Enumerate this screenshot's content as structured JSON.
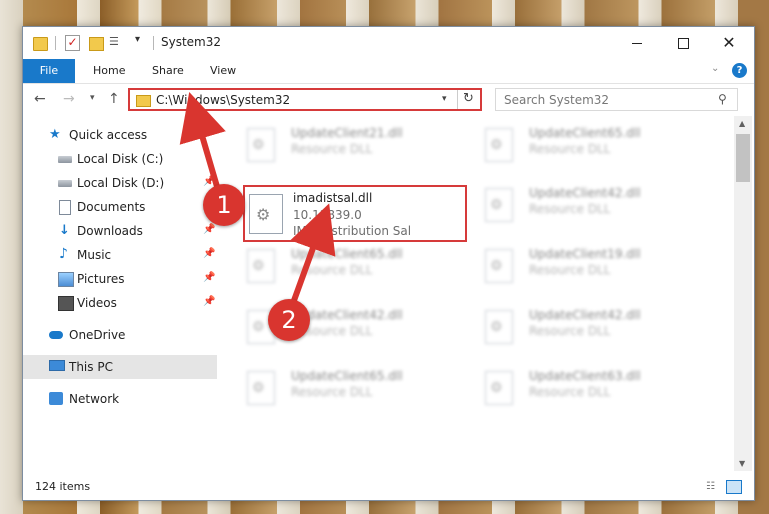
{
  "window": {
    "title": "System32",
    "controls": {
      "minimize": "—",
      "maximize": "☐",
      "close": "✕"
    }
  },
  "ribbon": {
    "tabs": [
      "File",
      "Home",
      "Share",
      "View"
    ],
    "help": "?"
  },
  "address": {
    "path": "C:\\Windows\\System32",
    "search_placeholder": "Search System32"
  },
  "sidebar": {
    "items": [
      {
        "label": "Quick access",
        "icon": "star-icon",
        "pinned": false
      },
      {
        "label": "Local Disk (C:)",
        "icon": "drive-icon",
        "pinned": false
      },
      {
        "label": "Local Disk (D:)",
        "icon": "drive-icon",
        "pinned": true
      },
      {
        "label": "Documents",
        "icon": "documents-icon",
        "pinned": true
      },
      {
        "label": "Downloads",
        "icon": "download-icon",
        "pinned": true
      },
      {
        "label": "Music",
        "icon": "music-icon",
        "pinned": true
      },
      {
        "label": "Pictures",
        "icon": "pictures-icon",
        "pinned": true
      },
      {
        "label": "Videos",
        "icon": "videos-icon",
        "pinned": true
      },
      {
        "label": "OneDrive",
        "icon": "cloud-icon",
        "pinned": false
      },
      {
        "label": "This PC",
        "icon": "computer-icon",
        "pinned": false,
        "selected": true
      },
      {
        "label": "Network",
        "icon": "network-icon",
        "pinned": false
      }
    ]
  },
  "files": {
    "highlighted": {
      "name": "imadistsal.dll",
      "version": "10.13839.0",
      "description": "IMA Distribution Sal"
    },
    "blurred": [
      {
        "name": "UpdateClient21.dll",
        "desc": "Resource DLL"
      },
      {
        "name": "UpdateClient65.dll",
        "desc": "Resource DLL"
      },
      {
        "name": "UpdateClient42.dll",
        "desc": "Resource DLL"
      },
      {
        "name": "UpdateClient65.dll",
        "desc": "Resource DLL"
      },
      {
        "name": "UpdateClient19.dll",
        "desc": "Resource DLL"
      },
      {
        "name": "UpdateClient42.dll",
        "desc": "Resource DLL"
      },
      {
        "name": "UpdateClient42.dll",
        "desc": "Resource DLL"
      },
      {
        "name": "UpdateClient65.dll",
        "desc": "Resource DLL"
      },
      {
        "name": "UpdateClient63.dll",
        "desc": "Resource DLL"
      }
    ]
  },
  "status": {
    "item_count": "124 items"
  },
  "callouts": [
    "1",
    "2"
  ],
  "colors": {
    "accent": "#1979ca",
    "highlight": "#d63a3a",
    "callout": "#d9352f"
  }
}
